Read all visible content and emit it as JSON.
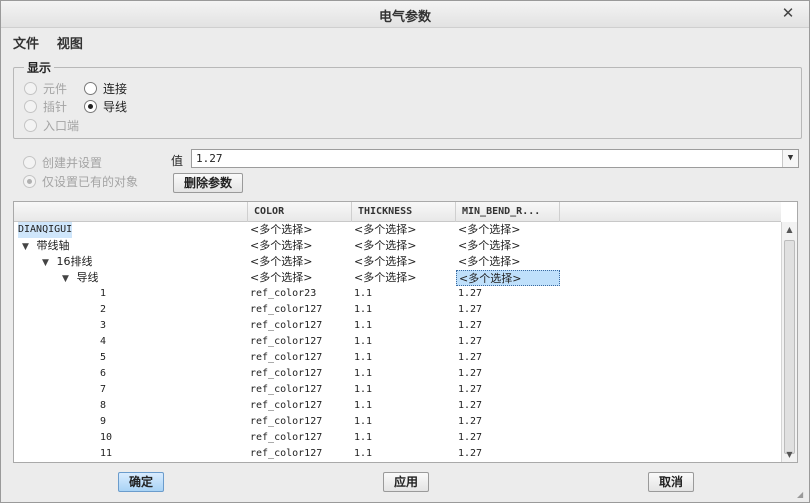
{
  "window": {
    "title": "电气参数",
    "close_glyph": "✕"
  },
  "menu": [
    "文件",
    "视图"
  ],
  "display": {
    "label": "显示",
    "options": [
      {
        "label": "元件",
        "checked": false,
        "disabled": true
      },
      {
        "label": "连接",
        "checked": false,
        "disabled": false
      },
      {
        "label": "插针",
        "checked": false,
        "disabled": true
      },
      {
        "label": "导线",
        "checked": true,
        "disabled": false
      },
      {
        "label": "入口端",
        "checked": false,
        "disabled": true
      }
    ]
  },
  "mode": {
    "options": [
      {
        "label": "创建并设置",
        "checked": false,
        "disabled": true
      },
      {
        "label": "仅设置已有的对象",
        "checked": true,
        "disabled": true
      }
    ]
  },
  "value": {
    "label": "值",
    "current": "1.27",
    "dropdown_glyph": "▼"
  },
  "delete_button": "删除参数",
  "table": {
    "columns": [
      "",
      "COLOR",
      "THICKNESS",
      "MIN_BEND_R..."
    ],
    "rows": [
      {
        "name": "DIANQIGUI",
        "color": "<多个选择>",
        "thickness": "<多个选择>",
        "min_bend": "<多个选择>"
      },
      {
        "name": "带线轴",
        "color": "<多个选择>",
        "thickness": "<多个选择>",
        "min_bend": "<多个选择>"
      },
      {
        "name": "16排线",
        "color": "<多个选择>",
        "thickness": "<多个选择>",
        "min_bend": "<多个选择>"
      },
      {
        "name": "导线",
        "color": "<多个选择>",
        "thickness": "<多个选择>",
        "min_bend": "<多个选择>"
      },
      {
        "name": "1",
        "color": "ref_color23",
        "thickness": "1.1",
        "min_bend": "1.27"
      },
      {
        "name": "2",
        "color": "ref_color127",
        "thickness": "1.1",
        "min_bend": "1.27"
      },
      {
        "name": "3",
        "color": "ref_color127",
        "thickness": "1.1",
        "min_bend": "1.27"
      },
      {
        "name": "4",
        "color": "ref_color127",
        "thickness": "1.1",
        "min_bend": "1.27"
      },
      {
        "name": "5",
        "color": "ref_color127",
        "thickness": "1.1",
        "min_bend": "1.27"
      },
      {
        "name": "6",
        "color": "ref_color127",
        "thickness": "1.1",
        "min_bend": "1.27"
      },
      {
        "name": "7",
        "color": "ref_color127",
        "thickness": "1.1",
        "min_bend": "1.27"
      },
      {
        "name": "8",
        "color": "ref_color127",
        "thickness": "1.1",
        "min_bend": "1.27"
      },
      {
        "name": "9",
        "color": "ref_color127",
        "thickness": "1.1",
        "min_bend": "1.27"
      },
      {
        "name": "10",
        "color": "ref_color127",
        "thickness": "1.1",
        "min_bend": "1.27"
      },
      {
        "name": "11",
        "color": "ref_color127",
        "thickness": "1.1",
        "min_bend": "1.27"
      }
    ]
  },
  "scroll": {
    "up": "▲",
    "down": "▼"
  },
  "footer": {
    "ok": "确定",
    "apply": "应用",
    "cancel": "取消"
  },
  "colors": {
    "accent": "#a9d3f5",
    "selection": "#bfe0fb"
  }
}
